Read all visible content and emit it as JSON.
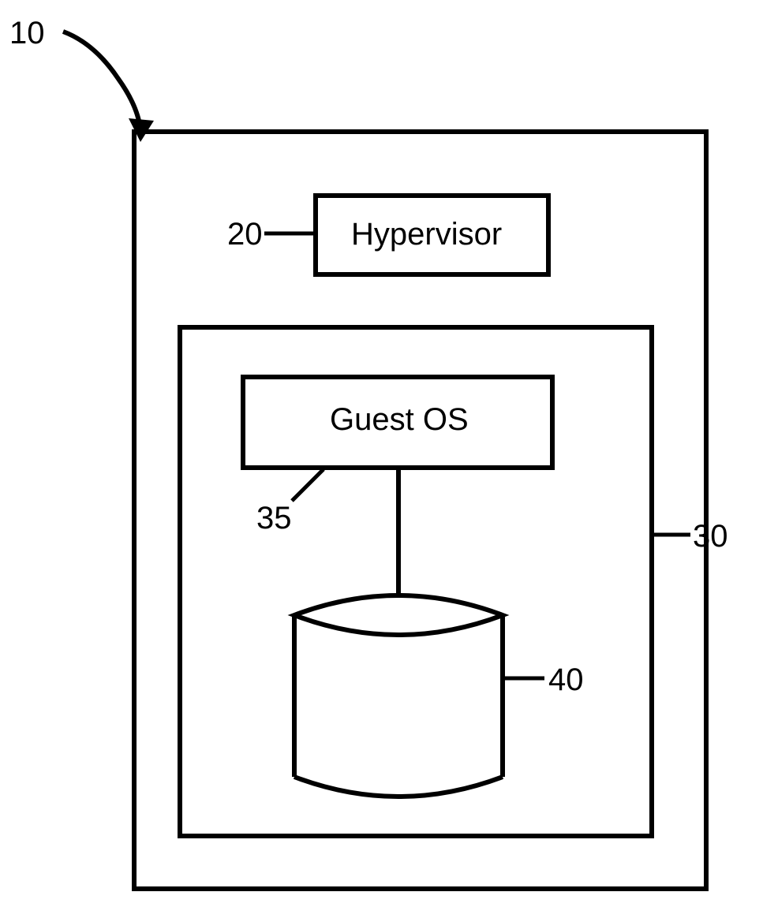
{
  "labels": {
    "system": "10",
    "hypervisor_ref": "20",
    "hypervisor_text": "Hypervisor",
    "container_ref": "30",
    "guest_os_ref": "35",
    "guest_os_text": "Guest OS",
    "storage_ref": "40"
  }
}
